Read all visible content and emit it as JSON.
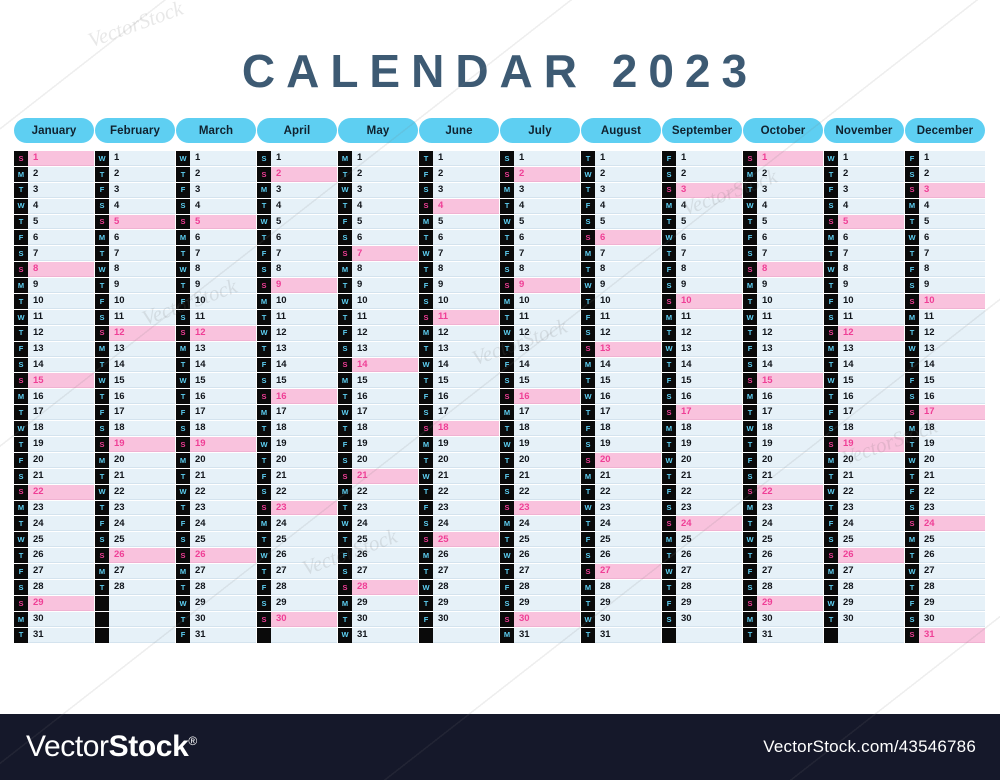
{
  "page": {
    "title": "CALENDAR 2023",
    "year": 2023,
    "background_color": "#ffffff"
  },
  "theme": {
    "title_color": "#3d5a73",
    "pill_bg": "#5ecff2",
    "pill_text": "#10222f",
    "dow_box_bg": "#0a0a0a",
    "dow_text": "#5ecff2",
    "sunday_text": "#ef3f96",
    "date_cell_bg": "#e6f1f8",
    "sunday_cell_bg": "#f9c2dd",
    "footer_bg": "#15182a"
  },
  "weekday_letters": [
    "S",
    "M",
    "T",
    "W",
    "T",
    "F",
    "S"
  ],
  "months": [
    {
      "name": "January",
      "days": 31,
      "start_index": 0,
      "sundays": [
        1,
        8,
        15,
        22,
        29
      ]
    },
    {
      "name": "February",
      "days": 28,
      "start_index": 3,
      "sundays": [
        5,
        12,
        19,
        26
      ]
    },
    {
      "name": "March",
      "days": 31,
      "start_index": 3,
      "sundays": [
        5,
        12,
        19,
        26
      ]
    },
    {
      "name": "April",
      "days": 30,
      "start_index": 6,
      "sundays": [
        2,
        9,
        16,
        23,
        30
      ]
    },
    {
      "name": "May",
      "days": 31,
      "start_index": 1,
      "sundays": [
        7,
        14,
        21,
        28
      ]
    },
    {
      "name": "June",
      "days": 30,
      "start_index": 4,
      "sundays": [
        4,
        11,
        18,
        25
      ]
    },
    {
      "name": "July",
      "days": 31,
      "start_index": 6,
      "sundays": [
        2,
        9,
        16,
        23,
        30
      ]
    },
    {
      "name": "August",
      "days": 31,
      "start_index": 2,
      "sundays": [
        6,
        13,
        20,
        27
      ]
    },
    {
      "name": "September",
      "days": 30,
      "start_index": 5,
      "sundays": [
        3,
        10,
        17,
        24
      ]
    },
    {
      "name": "October",
      "days": 31,
      "start_index": 0,
      "sundays": [
        1,
        8,
        15,
        22,
        29
      ]
    },
    {
      "name": "November",
      "days": 30,
      "start_index": 3,
      "sundays": [
        5,
        12,
        19,
        26
      ]
    },
    {
      "name": "December",
      "days": 31,
      "start_index": 5,
      "sundays": [
        3,
        10,
        17,
        24,
        31
      ]
    }
  ],
  "max_rows": 31,
  "watermark": {
    "words": [
      "VectorStock",
      "VectorStock",
      "VectorStock",
      "VectorStock",
      "VectorStock",
      "VectorStock"
    ]
  },
  "footer": {
    "logo_light": "Vector",
    "logo_bold": "Stock",
    "logo_mark": "®",
    "url": "VectorStock.com/43546786"
  }
}
